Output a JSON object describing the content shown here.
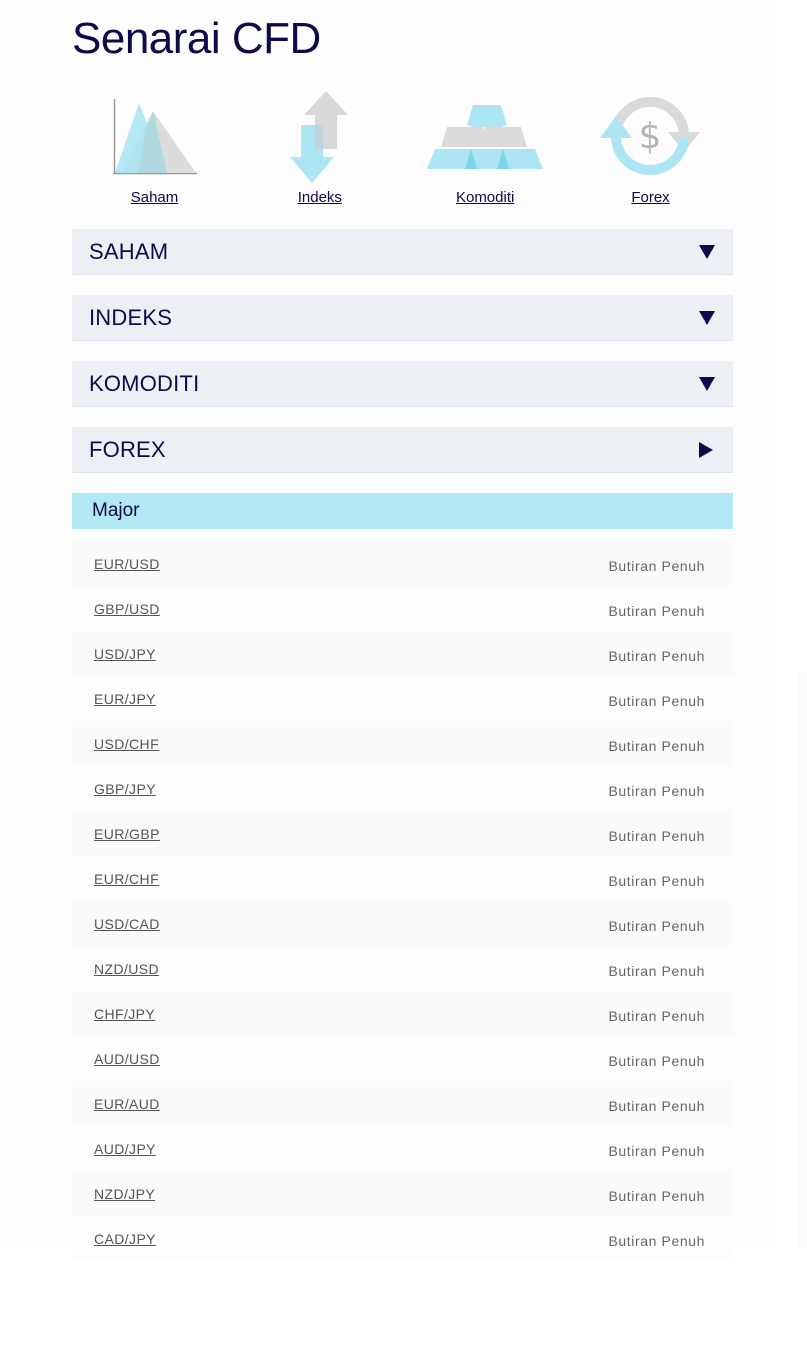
{
  "page": {
    "title": "Senarai CFD"
  },
  "categories": [
    {
      "label": "Saham",
      "icon": "stock-chart-icon"
    },
    {
      "label": "Indeks",
      "icon": "index-arrows-icon"
    },
    {
      "label": "Komoditi",
      "icon": "gold-bars-icon"
    },
    {
      "label": "Forex",
      "icon": "currency-exchange-icon"
    }
  ],
  "accordion": [
    {
      "title": "SAHAM",
      "state": "collapsed"
    },
    {
      "title": "INDEKS",
      "state": "collapsed"
    },
    {
      "title": "KOMODITI",
      "state": "collapsed"
    },
    {
      "title": "FOREX",
      "state": "expanded"
    }
  ],
  "forex": {
    "group_title": "Major",
    "detail_label": "Butiran Penuh",
    "pairs": [
      "EUR/USD",
      "GBP/USD",
      "USD/JPY",
      "EUR/JPY",
      "USD/CHF",
      "GBP/JPY",
      "EUR/GBP",
      "EUR/CHF",
      "USD/CAD",
      "NZD/USD",
      "CHF/JPY",
      "AUD/USD",
      "EUR/AUD",
      "AUD/JPY",
      "NZD/JPY",
      "CAD/JPY"
    ]
  },
  "colors": {
    "brand_navy": "#0c0a4a",
    "accent_cyan": "#b2e7f4",
    "header_grey": "#ecf0f5"
  }
}
